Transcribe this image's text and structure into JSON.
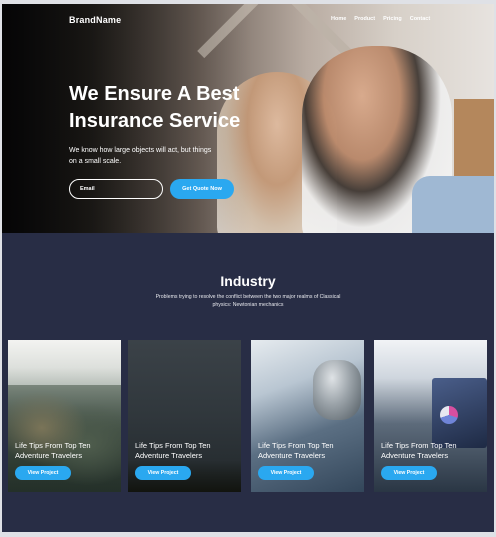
{
  "header": {
    "brand": "BrandName",
    "nav": [
      "Home",
      "Product",
      "Pricing",
      "Contact"
    ]
  },
  "hero": {
    "title": "We Ensure A Best Insurance Service",
    "subtitle": "We know how large objects will act, but things on a small scale.",
    "email_placeholder": "Email",
    "cta_label": "Get Quote Now"
  },
  "industry": {
    "title": "Industry",
    "description": "Problems trying to resolve the conflict between the two major realms of Classical physics: Newtonian mechanics",
    "cards": [
      {
        "title": "Life Tips From Top Ten Adventure Travelers",
        "button": "View Project"
      },
      {
        "title": "Life Tips From Top Ten Adventure Travelers",
        "button": "View Project"
      },
      {
        "title": "Life Tips From Top Ten Adventure Travelers",
        "button": "View Project"
      },
      {
        "title": "Life Tips From Top Ten Adventure Travelers",
        "button": "View Project"
      }
    ]
  },
  "colors": {
    "accent": "#2aa8f0",
    "section_bg": "#282d45"
  }
}
